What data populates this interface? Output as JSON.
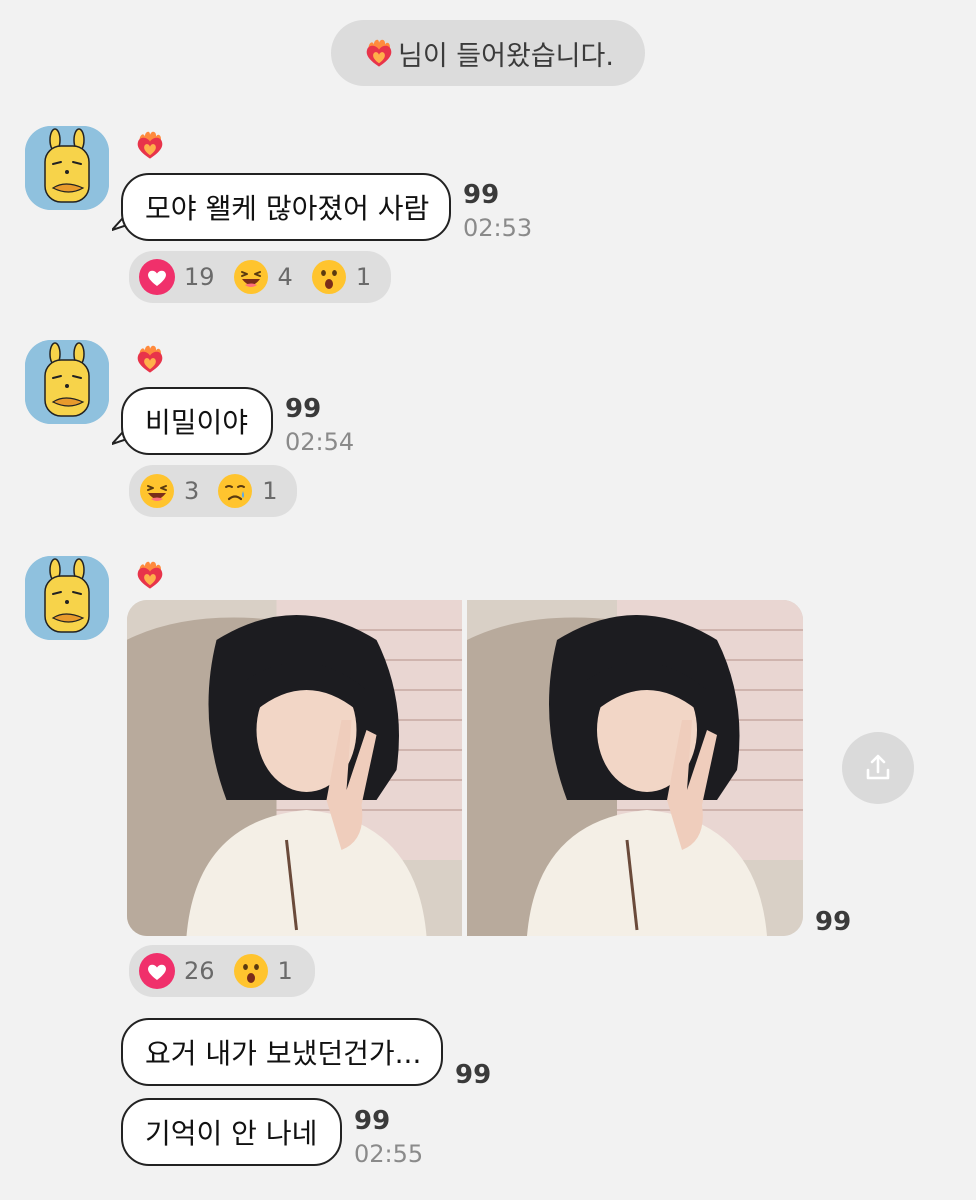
{
  "notice": {
    "text": "님이 들어왔습니다."
  },
  "messages": [
    {
      "text": "모야 왤케 많아졌어 사람",
      "count": "99",
      "time": "02:53",
      "reactions": [
        {
          "icon": "heart-icon",
          "count": "19"
        },
        {
          "icon": "grin-squint-emoji",
          "count": "4"
        },
        {
          "icon": "surprised-emoji",
          "count": "1"
        }
      ]
    },
    {
      "text": "비밀이야",
      "count": "99",
      "time": "02:54",
      "reactions": [
        {
          "icon": "grin-squint-emoji",
          "count": "3"
        },
        {
          "icon": "sad-tear-emoji",
          "count": "1"
        }
      ]
    },
    {
      "type": "photos",
      "count": "99",
      "reactions": [
        {
          "icon": "heart-icon",
          "count": "26"
        },
        {
          "icon": "surprised-emoji",
          "count": "1"
        }
      ]
    },
    {
      "text": "요거 내가 보냈던건가...",
      "count": "99"
    },
    {
      "text": "기억이 안 나네",
      "count": "99",
      "time": "02:55"
    }
  ],
  "colors": {
    "background": "#f2f2f2",
    "avatar_bg": "#8fc1de",
    "reaction_bg": "#dedede",
    "heart_pink": "#f0306b",
    "emoji_yellow": "#ffc42e"
  }
}
